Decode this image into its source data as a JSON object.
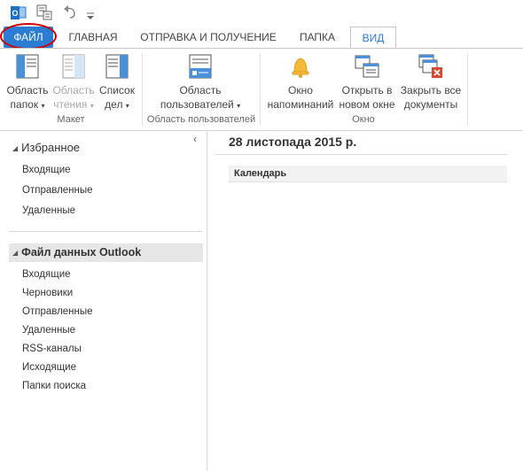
{
  "quick_access": {
    "icons": [
      "outlook-icon",
      "send-receive-icon",
      "undo-icon",
      "customize-icon"
    ]
  },
  "tabs": [
    {
      "label": "ФАЙЛ"
    },
    {
      "label": "ГЛАВНАЯ"
    },
    {
      "label": "ОТПРАВКА И ПОЛУЧЕНИЕ"
    },
    {
      "label": "ПАПКА"
    },
    {
      "label": "ВИД"
    }
  ],
  "ribbon": {
    "maket": {
      "label": "Макет",
      "folder_pane": {
        "line1": "Область",
        "line2": "папок"
      },
      "reading_pane": {
        "line1": "Область",
        "line2": "чтения"
      },
      "todo_list": {
        "line1": "Список",
        "line2": "дел"
      }
    },
    "people": {
      "label": "Область пользователей",
      "people_pane": {
        "line1": "Область",
        "line2": "пользователей"
      }
    },
    "window": {
      "label": "Окно",
      "reminders": {
        "line1": "Окно",
        "line2": "напоминаний"
      },
      "open_new": {
        "line1": "Открыть в",
        "line2": "новом окне"
      },
      "close_all": {
        "line1": "Закрыть все",
        "line2": "документы"
      }
    }
  },
  "nav": {
    "favorites_header": "Избранное",
    "favorites": [
      "Входящие",
      "Отправленные",
      "Удаленные"
    ],
    "data_file_header": "Файл данных Outlook",
    "data_file_items": [
      "Входящие",
      "Черновики",
      "Отправленные",
      "Удаленные",
      "RSS-каналы",
      "Исходящие",
      "Папки поиска"
    ]
  },
  "main": {
    "date": "28 листопада 2015 р.",
    "calendar_header": "Календарь"
  }
}
